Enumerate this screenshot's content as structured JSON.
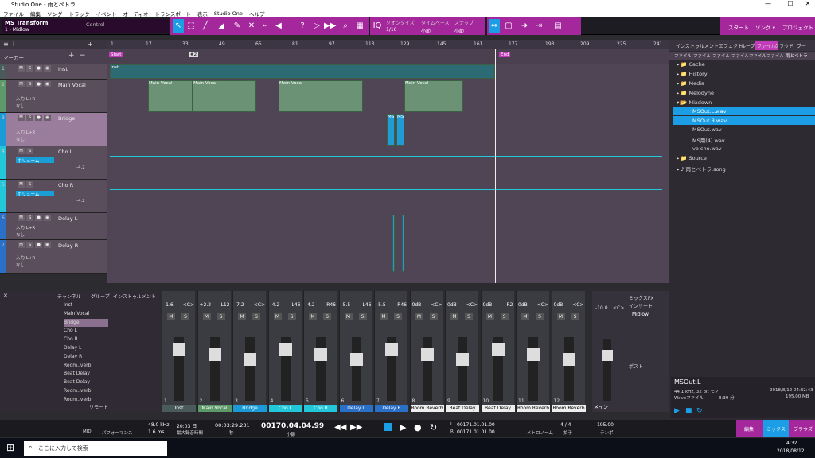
{
  "window": {
    "title": "Studio One - 雨とペトラ",
    "min": "—",
    "max": "☐",
    "close": "✕"
  },
  "menu": [
    "ファイル",
    "編集",
    "ソング",
    "トラック",
    "イベント",
    "オーディオ",
    "トランスポート",
    "表示",
    "Studio One",
    "ヘルプ"
  ],
  "toolbar": {
    "track_name": "MS Transform",
    "track_sub": "1 - Midlow",
    "control": "Control",
    "quantize_label": "クオンタイズ",
    "quantize_val": "1/16",
    "timebase_label": "タイムベース",
    "timebase_val": "小節",
    "snap_label": "スナップ",
    "snap_val": "小節",
    "start": "スタート",
    "song": "ソング ▾",
    "project": "プロジェクト"
  },
  "ruler": [
    "1",
    "17",
    "33",
    "49",
    "65",
    "81",
    "97",
    "113",
    "129",
    "145",
    "161",
    "177",
    "193",
    "209",
    "225",
    "241"
  ],
  "markers": {
    "label": "マーカー",
    "start": "Start",
    "end": "End",
    "m2": "#2"
  },
  "tracks": [
    {
      "n": "1",
      "name": "Inst",
      "input": "",
      "color": "#4a5a5a"
    },
    {
      "n": "2",
      "name": "Main Vocal",
      "input": "入力 L+R",
      "none": "なし",
      "color": "#5d9a6a"
    },
    {
      "n": "3",
      "name": "Bridge",
      "input": "入力 L+R",
      "none": "なし",
      "color": "#1a9bd8"
    },
    {
      "n": "4",
      "name": "Cho L",
      "auto": "ボリューム",
      "val": "-4.2",
      "color": "#23c7da"
    },
    {
      "n": "5",
      "name": "Cho R",
      "auto": "ボリューム",
      "val": "-4.2",
      "color": "#23c7da"
    },
    {
      "n": "6",
      "name": "Delay L",
      "input": "入力 L+R",
      "none": "なし",
      "color": "#2a70c8"
    },
    {
      "n": "7",
      "name": "Delay R",
      "input": "入力 L+R",
      "none": "なし",
      "color": "#2a70c8"
    }
  ],
  "clips": {
    "inst": "Inst",
    "main": "Main Vocal",
    "ms": "MS"
  },
  "browser": {
    "tabs": [
      "インストゥルメント",
      "エフェクト",
      "ループ",
      "ファイル",
      "クラウド",
      "プー"
    ],
    "subtabs": [
      "ファイル",
      "ファイル",
      "ファイル",
      "ファイル",
      "ファイル",
      "ファイル",
      "ファイル",
      "雨とペトラ"
    ],
    "items": [
      "Cache",
      "History",
      "Media",
      "Melodyne",
      "Mixdown",
      "MSOut.L.wav",
      "MSOut.R.wav",
      "MSOut.wav",
      "MS用(4).wav",
      "vo cho.wav",
      "Source",
      "雨とペトラ.song"
    ],
    "info_name": "MSOut.L",
    "info_fmt": "44.1 kHz, 32 bit モノ",
    "info_type": "Waveファイル",
    "info_len": "3:39 分",
    "info_date": "2018/8/12 04:32:43",
    "info_size": "195.00 MB"
  },
  "mixer": {
    "channel_hdr": "チャンネル",
    "group_hdr": "グループ",
    "inst_hdr": "インストゥルメント",
    "list": [
      "Inst",
      "Main Vocal",
      "Bridge",
      "Cho L",
      "Cho R",
      "Delay L",
      "Delay R",
      "Room..verb",
      "Beat Delay",
      "Beat Delay",
      "Room..verb",
      "Room..verb"
    ],
    "strips": [
      {
        "n": "1",
        "name": "Inst",
        "vol": "-1.6",
        "pan": "<C>",
        "c": "#4b5a5a"
      },
      {
        "n": "2",
        "name": "Main Vocal",
        "vol": "+2.2",
        "pan": "L12",
        "c": "#5d9a6a"
      },
      {
        "n": "3",
        "name": "Bridge",
        "vol": "-7.2",
        "pan": "<C>",
        "c": "#1a9bd8"
      },
      {
        "n": "4",
        "name": "Cho L",
        "vol": "-4.2",
        "pan": "L46",
        "c": "#23c7da"
      },
      {
        "n": "5",
        "name": "Cho R",
        "vol": "-4.2",
        "pan": "R46",
        "c": "#23c7da"
      },
      {
        "n": "6",
        "name": "Delay L",
        "vol": "-5.5",
        "pan": "L46",
        "c": "#2a70c8"
      },
      {
        "n": "7",
        "name": "Delay R",
        "vol": "-5.5",
        "pan": "R46",
        "c": "#2a70c8"
      },
      {
        "n": "8",
        "name": "Room Reverb",
        "vol": "0dB",
        "pan": "<C>",
        "c": "#eeeeee"
      },
      {
        "n": "9",
        "name": "Beat Delay",
        "vol": "0dB",
        "pan": "<C>",
        "c": "#eeeeee"
      },
      {
        "n": "10",
        "name": "Beat Delay",
        "vol": "0dB",
        "pan": "R2",
        "c": "#eeeeee"
      },
      {
        "n": "11",
        "name": "Room Reverb",
        "vol": "0dB",
        "pan": "<C>",
        "c": "#eeeeee"
      },
      {
        "n": "12",
        "name": "Room Reverb",
        "vol": "0dB",
        "pan": "<C>",
        "c": "#eeeeee"
      }
    ],
    "main": "メイン",
    "main_vol": "-10.0",
    "main_pan": "<C>",
    "mix_fx": "ミックスFX",
    "insert": "インサート",
    "midlow": "Midlow",
    "post": "ポスト",
    "remote": "リモート"
  },
  "transport": {
    "midi": "MIDI",
    "perf": "パフォーマンス",
    "rate": "48.0 kHz",
    "lat": "1.6 ms",
    "time": "20:03 日",
    "time_lbl": "最大録音時間",
    "clock": "00:03:29.231",
    "clock_lbl": "秒",
    "bars": "00170.04.04.99",
    "bars_lbl": "小節",
    "L": "00171.01.01.00",
    "R": "00171.01.01.00",
    "sig": "4 / 4",
    "sig_lbl": "拍子",
    "tempo": "195.00",
    "tempo_lbl": "テンポ",
    "metro": "メトロノーム",
    "edit": "編集",
    "mix": "ミックス",
    "browse": "ブラウズ"
  },
  "taskbar": {
    "search": "ここに入力して検索",
    "clock": "4:32",
    "date": "2018/08/12"
  }
}
